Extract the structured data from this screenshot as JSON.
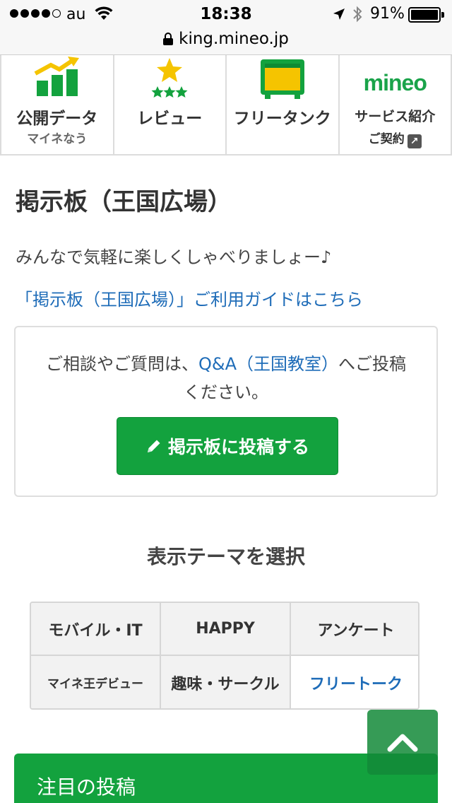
{
  "status_bar": {
    "carrier": "au",
    "time": "18:38",
    "battery": "91%"
  },
  "url_bar": {
    "url": "king.mineo.jp"
  },
  "nav": [
    {
      "label": "公開データ",
      "sub": "マイネなう",
      "icon": "chart-up-icon"
    },
    {
      "label": "レビュー",
      "sub": "",
      "icon": "star-rating-icon"
    },
    {
      "label": "フリータンク",
      "sub": "",
      "icon": "tank-icon"
    },
    {
      "logo": "mineo",
      "label": "サービス紹介",
      "sub": "ご契約",
      "icon": "external-link-icon"
    }
  ],
  "page": {
    "title": "掲示板（王国広場）",
    "description": "みんなで気軽に楽しくしゃべりましょー♪",
    "guide_link": "「掲示板（王国広場）」ご利用ガイドはこちら"
  },
  "notice": {
    "text_before": "ご相談やご質問は、",
    "link": "Q&A（王国教室）",
    "text_after": "へご投稿ください。",
    "button_label": "掲示板に投稿する",
    "button_icon": "pencil-icon"
  },
  "theme": {
    "heading": "表示テーマを選択",
    "items": [
      "モバイル・IT",
      "HAPPY",
      "アンケート",
      "マイネ王デビュー",
      "趣味・サークル",
      "フリートーク"
    ],
    "active": "フリートーク"
  },
  "featured": {
    "title": "注目の投稿"
  },
  "colors": {
    "brand_green": "#13a23e",
    "link_blue": "#1e6cb8",
    "icon_yellow": "#f5c400"
  }
}
